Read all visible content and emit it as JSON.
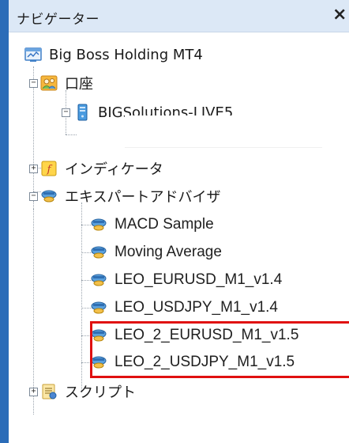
{
  "window": {
    "title": "ナビゲーター",
    "close_glyph": "×"
  },
  "tree": {
    "root": {
      "label": "Big Boss Holding MT4",
      "icon": "terminal-icon"
    },
    "accounts": {
      "label": "口座",
      "icon": "accounts-icon",
      "expanded": true,
      "server": {
        "label": "BIGSolutions-LIVE5",
        "icon": "server-icon"
      }
    },
    "indicators": {
      "label": "インディケータ",
      "icon": "indicator-icon",
      "expanded": false
    },
    "experts": {
      "label": "エキスパートアドバイザ",
      "icon": "expert-advisor-icon",
      "expanded": true,
      "items": [
        {
          "label": "MACD Sample",
          "icon": "expert-advisor-icon"
        },
        {
          "label": "Moving Average",
          "icon": "expert-advisor-icon"
        },
        {
          "label": "LEO_EURUSD_M1_v1.4",
          "icon": "expert-advisor-icon"
        },
        {
          "label": "LEO_USDJPY_M1_v1.4",
          "icon": "expert-advisor-icon"
        },
        {
          "label": "LEO_2_EURUSD_M1_v1.5",
          "icon": "expert-advisor-icon",
          "highlighted": true
        },
        {
          "label": "LEO_2_USDJPY_M1_v1.5",
          "icon": "expert-advisor-icon",
          "highlighted": true
        }
      ]
    },
    "scripts": {
      "label": "スクリプト",
      "icon": "script-icon",
      "expanded": false
    }
  },
  "colors": {
    "frame": "#2b6cb8",
    "titlebar": "#dce8f6",
    "highlight_box": "#e01010"
  }
}
